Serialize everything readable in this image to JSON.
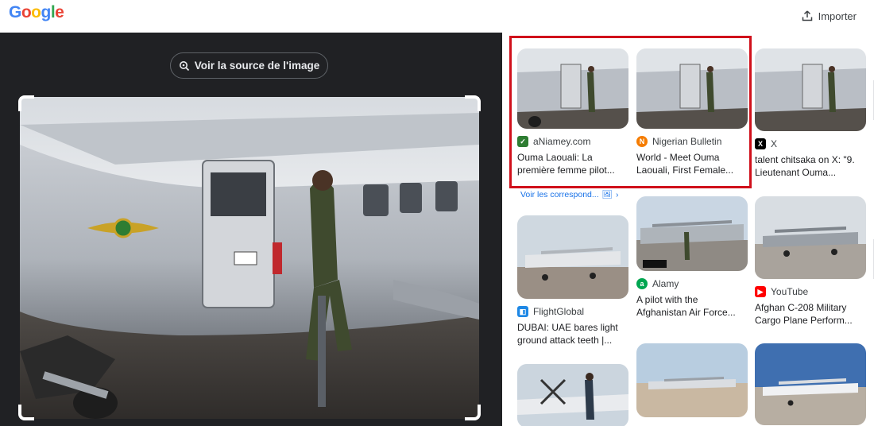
{
  "header": {
    "logo_letters": [
      "G",
      "o",
      "o",
      "g",
      "l",
      "e"
    ],
    "import_label": "Importer"
  },
  "viewer": {
    "source_button_label": "Voir la source de l'image"
  },
  "results": {
    "more_matches_label": "Voir les correspond...",
    "cards": [
      {
        "source": "aNiamey.com",
        "title": "Ouma Laouali: La première femme pilot...",
        "favicon_color": "#2e7d32"
      },
      {
        "source": "Nigerian Bulletin",
        "title": "World - Meet Ouma Laouali, First Female...",
        "favicon_color": "#f57c00"
      },
      {
        "source": "X",
        "title": "talent chitsaka on X: \"9. Lieutenant Ouma...",
        "favicon_color": "#000000"
      },
      {
        "source": "Alamy",
        "title": "A pilot with the Afghanistan Air Force...",
        "favicon_color": "#00a651"
      },
      {
        "source": "YouTube",
        "title": "Afghan C-208 Military Cargo Plane Perform...",
        "favicon_color": "#ff0000"
      },
      {
        "source": "FlightGlobal",
        "title": "DUBAI: UAE bares light ground attack teeth |...",
        "favicon_color": "#1e88e5"
      }
    ]
  },
  "colors": {
    "highlight": "#d0101b",
    "viewer_bg": "#202124",
    "link": "#1a73e8"
  }
}
